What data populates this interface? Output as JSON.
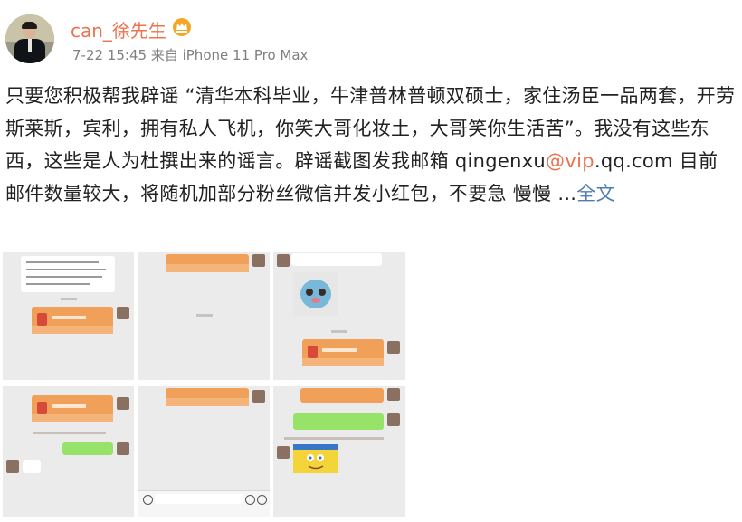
{
  "post": {
    "username": "can_徐先生",
    "timestamp": "7-22 15:45",
    "source": "来自 iPhone 11 Pro Max",
    "text_1": "只要您积极帮我辟谣 “清华本科毕业，牛津普林普顿双硕士，家住汤臣一品两套，开劳斯莱斯，宾利，拥有私人飞机，你笑大哥化妆土，大哥笑你生活苦”。我没有这些东西，这些是人为杜撰出来的谣言。辟谣截图发我邮箱 qingenxu",
    "mention": "@vip",
    "text_2": ".qq.com 目前邮件数量较大，将随机加部分粉丝微信并发小红包，不要急 慢慢 ...",
    "more_link": "全文"
  },
  "icons": {
    "vip_badge": "vip-crown-icon",
    "vip_color": "#f6a623",
    "accent_color": "#eb7350",
    "link_color": "#507daf"
  },
  "images": [
    {
      "name": "screenshot-1"
    },
    {
      "name": "screenshot-2"
    },
    {
      "name": "screenshot-3"
    },
    {
      "name": "screenshot-4"
    },
    {
      "name": "screenshot-5"
    },
    {
      "name": "screenshot-6"
    }
  ]
}
